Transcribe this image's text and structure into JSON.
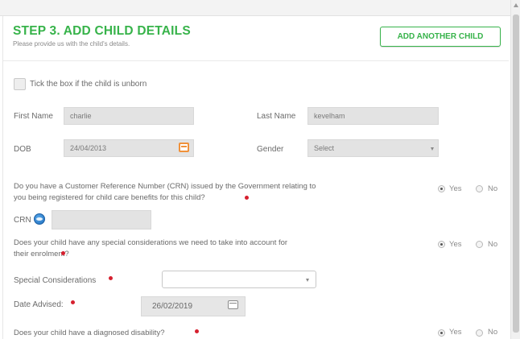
{
  "header": {
    "title": "STEP 3. ADD CHILD DETAILS",
    "subtitle": "Please provide us with the child's details.",
    "add_button": "ADD ANOTHER CHILD"
  },
  "unborn": {
    "label": "Tick the box if the child is unborn",
    "checked": false
  },
  "first_name": {
    "label": "First Name",
    "value": "charlie"
  },
  "last_name": {
    "label": "Last Name",
    "value": "kevelham"
  },
  "dob": {
    "label": "DOB",
    "value": "24/04/2013"
  },
  "gender": {
    "label": "Gender",
    "value": "Select"
  },
  "crn_question": {
    "line1": "Do you have a Customer Reference Number (CRN) issued by the Government relating to",
    "line2": "you being registered for child care benefits for this child?",
    "yes": "Yes",
    "no": "No",
    "selected": "Yes"
  },
  "crn": {
    "label": "CRN",
    "value": ""
  },
  "special_question": {
    "line1": "Does your child have any special considerations we need to take into account for",
    "line2": "their enrolment?",
    "yes": "Yes",
    "no": "No",
    "selected": "Yes"
  },
  "special_considerations": {
    "label": "Special Considerations",
    "value": ""
  },
  "date_advised": {
    "label": "Date Advised:",
    "value": "26/02/2019"
  },
  "disability_question": {
    "line1": "Does your child have a diagnosed disability?",
    "yes": "Yes",
    "no": "No",
    "selected": "Yes"
  },
  "colors": {
    "accent_green": "#37b34a",
    "required_red": "#d6202f",
    "calendar_orange": "#f0913a"
  }
}
